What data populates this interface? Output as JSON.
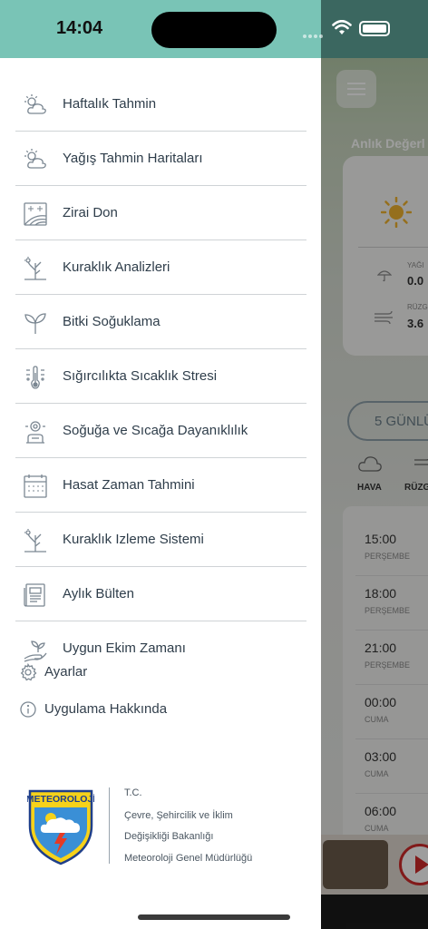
{
  "status_bar": {
    "time": "14:04"
  },
  "background": {
    "section_title": "Anlık Değerl",
    "precip_label": "YAĞI",
    "precip_value": "0.0",
    "wind_label": "RÜZG",
    "wind_value": "3.6",
    "forecast_pill": "5 GÜNLÜ",
    "tab_weather": "HAVA",
    "tab_wind": "RÜZG",
    "rows": [
      {
        "time": "15:00",
        "day": "PERŞEMBE"
      },
      {
        "time": "18:00",
        "day": "PERŞEMBE"
      },
      {
        "time": "21:00",
        "day": "PERŞEMBE"
      },
      {
        "time": "00:00",
        "day": "CUMA"
      },
      {
        "time": "03:00",
        "day": "CUMA"
      },
      {
        "time": "06:00",
        "day": "CUMA"
      }
    ]
  },
  "drawer": {
    "menu_items": [
      {
        "label": "Haftalık Tahmin",
        "icon": "partly-cloudy-icon"
      },
      {
        "label": "Yağış Tahmin Haritaları",
        "icon": "partly-cloudy-icon"
      },
      {
        "label": "Zirai Don",
        "icon": "frost-field-icon"
      },
      {
        "label": "Kuraklık Analizleri",
        "icon": "drought-tree-icon"
      },
      {
        "label": "Bitki Soğuklama",
        "icon": "sprout-icon"
      },
      {
        "label": "Sığırcılıkta Sıcaklık Stresi",
        "icon": "thermometer-icon"
      },
      {
        "label": "Soğuğa ve Sıcağa Dayanıklılık",
        "icon": "resistance-icon"
      },
      {
        "label": "Hasat Zaman Tahmini",
        "icon": "calendar-icon"
      },
      {
        "label": "Kuraklık Izleme Sistemi",
        "icon": "drought-tree-icon"
      },
      {
        "label": "Aylık Bülten",
        "icon": "bulletin-icon"
      },
      {
        "label": "Uygun Ekim Zamanı",
        "icon": "planting-hand-icon"
      }
    ],
    "settings_label": "Ayarlar",
    "about_label": "Uygulama Hakkında",
    "footer": {
      "logo_text": "METEOROLOJİ",
      "org_line1": "T.C.",
      "org_line2": "Çevre, Şehircilik ve İklim",
      "org_line3": "Değişikliği Bakanlığı",
      "org_line4": "Meteoroloji Genel Müdürlüğü"
    }
  },
  "colors": {
    "accent": "#79c4b6",
    "text": "#2e3d4a",
    "divider": "#cfd3d6",
    "icon_stroke": "#7b8792"
  }
}
